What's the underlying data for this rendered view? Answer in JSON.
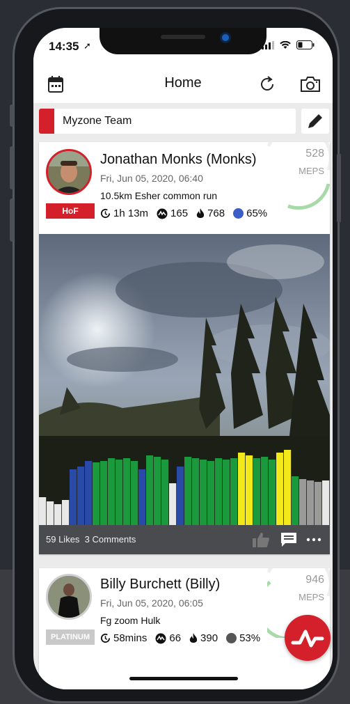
{
  "status": {
    "time": "14:35"
  },
  "header": {
    "title": "Home"
  },
  "team": {
    "label": "Myzone Team"
  },
  "posts": [
    {
      "name": "Jonathan Monks (Monks)",
      "date": "Fri, Jun 05, 2020, 06:40",
      "description": "10.5km Esher common run",
      "badge": "HoF",
      "duration": "1h 13m",
      "effort": "165",
      "calories": "768",
      "percent": "65%",
      "meps": "528",
      "meps_label": "MEPS",
      "likes": "59 Likes",
      "comments": "3 Comments"
    },
    {
      "name": "Billy Burchett (Billy)",
      "date": "Fri, Jun 05, 2020, 06:05",
      "description": "Fg zoom Hulk",
      "badge": "PLATINUM",
      "duration": "58mins",
      "effort": "66",
      "calories": "390",
      "percent": "53%",
      "meps": "946",
      "meps_label": "MEPS"
    }
  ],
  "colors": {
    "brand_red": "#d3202a",
    "zone_green": "#1a9a3c",
    "zone_blue": "#2a4aa8",
    "zone_yellow": "#f2e81a",
    "zone_gray": "#9a9a9a",
    "zone_white": "#e8e8e8"
  }
}
